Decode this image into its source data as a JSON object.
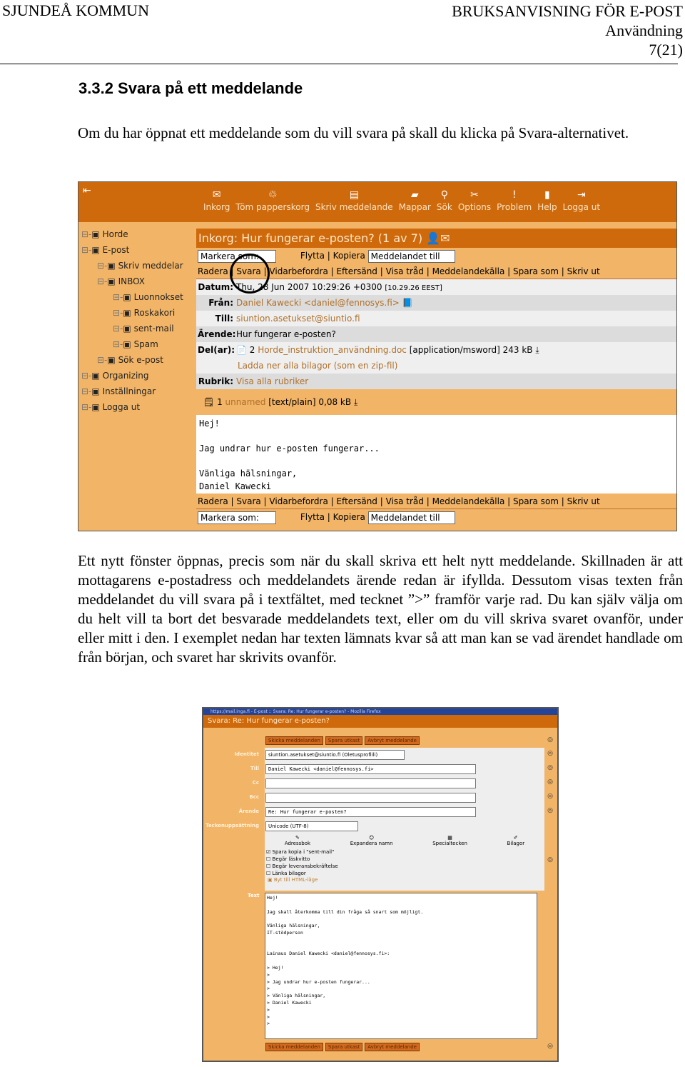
{
  "header": {
    "org": "SJUNDEÅ KOMMUN",
    "doc_title": "BRUKSANVISNING FÖR E-POST",
    "section": "Användning",
    "page": "7(21)"
  },
  "heading": "3.3.2 Svara på ett meddelande",
  "intro": "Om du har öppnat ett meddelande som du vill svara på skall du klicka på Svara-alternativet.",
  "paragraph2": "Ett nytt fönster öppnas, precis som när du skall skriva ett helt nytt meddelande. Skillnaden är att mottagarens e-postadress och meddelandets ärende redan är ifyllda. Dessutom visas texten från meddelandet du vill svara på i textfältet, med tecknet ”>” framför varje rad. Du kan själv välja om du helt vill ta bort det besvarade meddelandets text, eller om du vill skriva svaret ovanför, under eller mitt i den. I exemplet nedan har texten lämnats kvar så att man kan se vad ärendet handlade om från början, och svaret har skrivits ovanför.",
  "colors": {
    "accent": "#cf6a0c",
    "panel": "#f2b466"
  },
  "screenshot1": {
    "toolbar": [
      {
        "label": "Inkorg",
        "icon": "envelope-icon"
      },
      {
        "label": "Töm papperskorg",
        "icon": "trash-icon"
      },
      {
        "label": "Skriv meddelande",
        "icon": "compose-icon"
      },
      {
        "label": "Mappar",
        "icon": "folder-icon"
      },
      {
        "label": "Sök",
        "icon": "search-icon"
      },
      {
        "label": "Options",
        "icon": "tools-icon"
      },
      {
        "label": "Problem",
        "icon": "alert-icon"
      },
      {
        "label": "Help",
        "icon": "help-book-icon"
      },
      {
        "label": "Logga ut",
        "icon": "logout-icon"
      }
    ],
    "sidebar": [
      "Horde",
      "E-post",
      "Skriv meddelar",
      "INBOX",
      "Luonnokset",
      "Roskakori",
      "sent-mail",
      "Spam",
      "Sök e-post",
      "Organizing",
      "Inställningar",
      "Logga ut"
    ],
    "title": "Inkorg: Hur fungerar e-posten? (1 av 7)",
    "mark_select": "Markera som:",
    "move_copy": "Flytta | Kopiera",
    "move_target": "Meddelandet till",
    "actions": "Radera | Svara | Vidarbefordra | Eftersänd | Visa tråd | Meddelandekälla | Spara som | Skriv ut",
    "date_label": "Datum:",
    "date": "Thu, 28 Jun 2007 10:29:26 +0300",
    "date_local": "[10.29.26 EEST]",
    "from_label": "Från:",
    "from": "Daniel Kawecki <daniel@fennosys.fi>",
    "to_label": "Till:",
    "to": "siuntion.asetukset@siuntio.fi",
    "subject_label": "Ärende:",
    "subject": "Hur fungerar e-posten?",
    "parts_label": "Del(ar):",
    "part_no": "2",
    "part_name": "Horde_instruktion_användning.doc",
    "part_type": "[application/msword]",
    "part_size": "243 kB",
    "download_all": "Ladda ner alla bilagor (som en zip-fil)",
    "headers_label": "Rubrik:",
    "headers_link": "Visa alla rubriker",
    "part1_no": "1",
    "part1_name": "unnamed",
    "part1_type": "[text/plain]",
    "part1_size": "0,08 kB",
    "body": "Hej!\n\nJag undrar hur e-posten fungerar...\n\nVänliga hälsningar,\nDaniel Kawecki"
  },
  "screenshot2": {
    "window_title": "https://mail.inga.fi - E-post :: Svara: Re: Hur fungerar e-posten? - Mozilla Firefox",
    "title": "Svara: Re: Hur fungerar e-posten?",
    "buttons": [
      "Skicka meddelanden",
      "Spara utkast",
      "Avbryt meddelande"
    ],
    "identity_label": "Identitet",
    "identity": "siuntion.asetukset@siuntio.fi (Oletusprofiili)",
    "to_label": "Till",
    "to": "Daniel Kawecki <daniel@fennosys.fi>",
    "cc_label": "Cc",
    "bcc_label": "Bcc",
    "subject_label": "Ärende",
    "subject": "Re: Hur fungerar e-posten?",
    "charset_label": "Teckenuppsättning",
    "charset": "Unicode (UTF-8)",
    "tools": [
      "Adressbok",
      "Expandera namn",
      "Specialtecken",
      "Bilagor"
    ],
    "options": [
      {
        "label": "Spara kopia i \"sent-mail\"",
        "checked": true
      },
      {
        "label": "Begär läskvitto",
        "checked": false
      },
      {
        "label": "Begär leveransbekräftelse",
        "checked": false
      },
      {
        "label": "Länka bilagor",
        "checked": false
      }
    ],
    "html_mode": "Byt till HTML-läge",
    "text_label": "Text",
    "text": "Hej!\n\nJag skall återkomma till din fråga så snart som möjligt.\n\nVänliga hälsningar,\nIT-stödperson\n\n\nLainaus Daniel Kawecki <daniel@fennosys.fi>:\n\n> Hej!\n>\n> Jag undrar hur e-posten fungerar...\n>\n> Vänliga hälsningar,\n> Daniel Kawecki\n>\n>\n>"
  }
}
